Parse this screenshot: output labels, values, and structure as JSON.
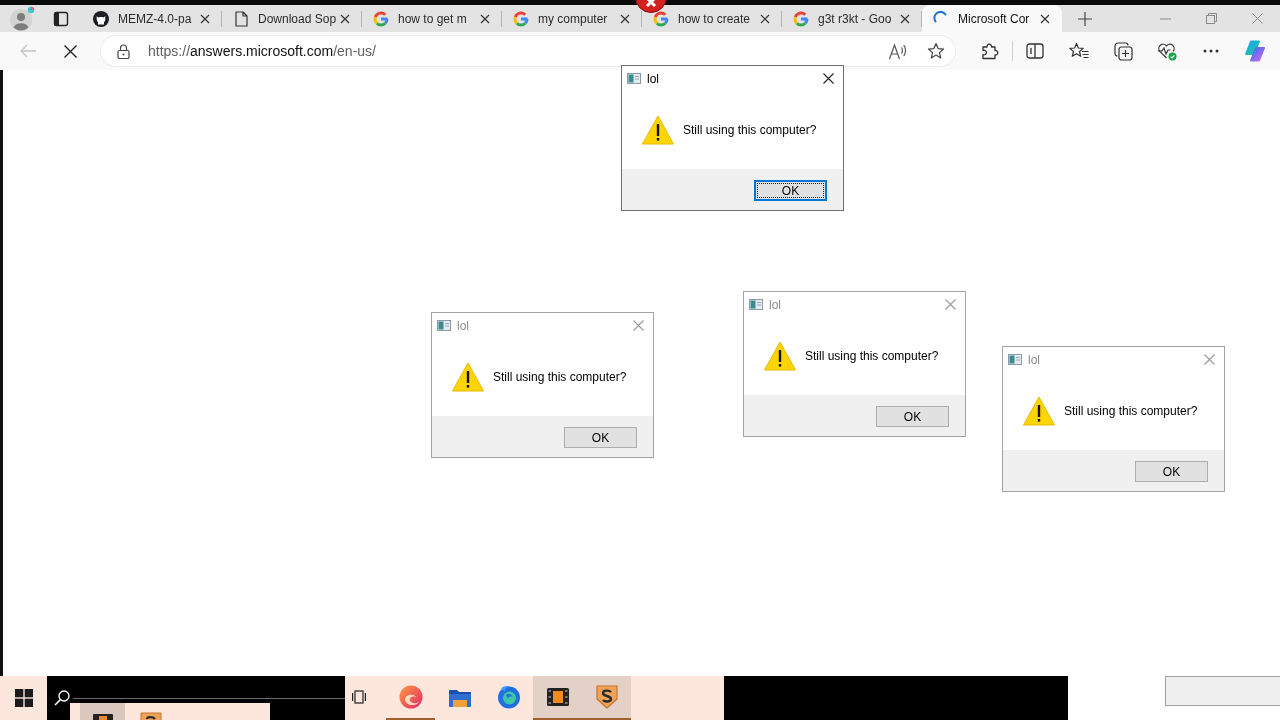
{
  "browser": {
    "tabs": [
      {
        "kind": "cat",
        "title": "MEMZ-4.0-pa",
        "selected": false
      },
      {
        "kind": "page",
        "title": "Download Sop",
        "selected": false
      },
      {
        "kind": "ring",
        "title": "how to get m",
        "selected": false
      },
      {
        "kind": "ring",
        "title": "my computer",
        "selected": false
      },
      {
        "kind": "ring",
        "title": "how to create",
        "selected": false
      },
      {
        "kind": "ring",
        "title": "g3t r3kt - Goo",
        "selected": false
      },
      {
        "kind": "spinner",
        "title": "Microsoft Cor",
        "selected": true
      }
    ],
    "back_disabled": true,
    "loading": true,
    "url": {
      "scheme": "https://",
      "host": "answers.microsoft.com",
      "path": "/en-us/"
    }
  },
  "dialogs": [
    {
      "title": "lol",
      "message": "Still using this computer?",
      "button": "OK",
      "active": true
    },
    {
      "title": "lol",
      "message": "Still using this computer?",
      "button": "OK",
      "active": false
    },
    {
      "title": "lol",
      "message": "Still using this computer?",
      "button": "OK",
      "active": false
    },
    {
      "title": "lol",
      "message": "Still using this computer?",
      "button": "OK",
      "active": false
    }
  ],
  "taskbar": {
    "items": [
      {
        "kind": "task-view",
        "running": false,
        "active": false
      },
      {
        "kind": "swirl",
        "running": true,
        "active": false
      },
      {
        "kind": "folder",
        "running": false,
        "active": false
      },
      {
        "kind": "flame-globe",
        "running": false,
        "active": false
      },
      {
        "kind": "film",
        "running": true,
        "active": true
      },
      {
        "kind": "shield",
        "running": true,
        "active": true
      }
    ]
  }
}
